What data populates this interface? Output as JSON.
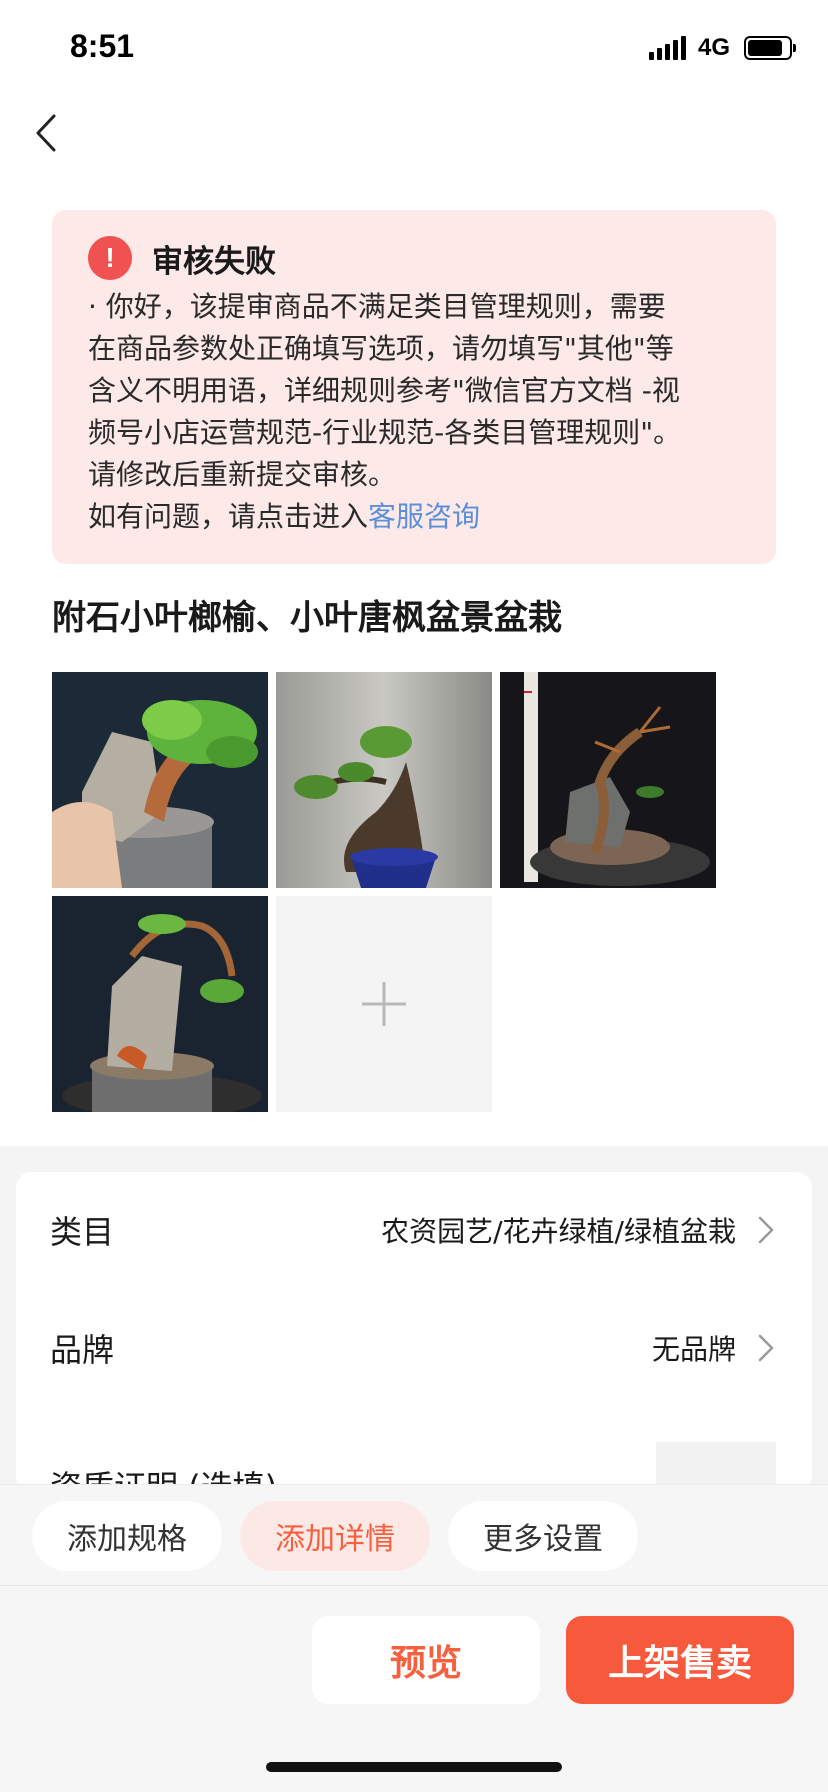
{
  "status_bar": {
    "time": "8:51",
    "network": "4G"
  },
  "notice": {
    "title": "审核失败",
    "lines": [
      "· 你好，该提审商品不满足类目管理规则，需要",
      "在商品参数处正确填写选项，请勿填写\"其他\"等",
      "含义不明用语，详细规则参考\"微信官方文档 -视",
      "频号小店运营规范-行业规范-各类目管理规则\"。",
      "请修改后重新提交审核。"
    ],
    "help_prefix": "如有问题，请点击进入",
    "help_link": "客服咨询"
  },
  "product": {
    "title": "附石小叶榔榆、小叶唐枫盆景盆栽"
  },
  "form": {
    "category_label": "类目",
    "category_value": "农资园艺/花卉绿植/绿植盆栽",
    "brand_label": "品牌",
    "brand_value": "无品牌",
    "cert_label": "资质证明 (选填)"
  },
  "actions": {
    "add_spec": "添加规格",
    "add_detail": "添加详情",
    "more_settings": "更多设置"
  },
  "buttons": {
    "preview": "预览",
    "publish": "上架售卖"
  },
  "colors": {
    "accent": "#f7593d",
    "link": "#5b8fd8",
    "error": "#f05151",
    "notice_bg": "#fce9e8"
  }
}
